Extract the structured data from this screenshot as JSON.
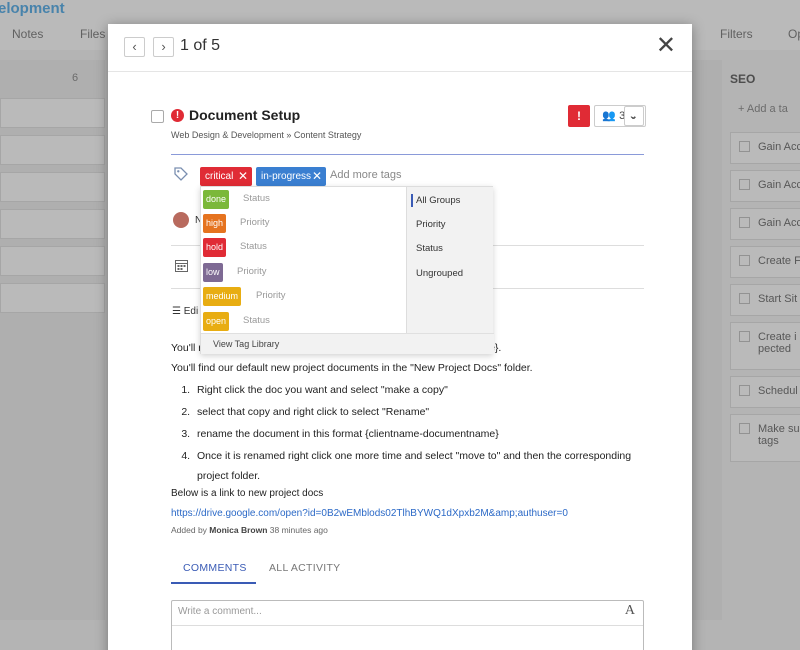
{
  "background": {
    "project_title": "elopment",
    "tabs": [
      "Notes",
      "Files",
      "Filters",
      "Op"
    ],
    "column_count": "6",
    "seo": {
      "title": "SEO",
      "add_label": "Add a ta",
      "items": [
        "Gain Acc",
        "Gain Acc",
        "Gain Acc",
        "Create F",
        "Start Sit",
        "Create i",
        "pected",
        "Schedul",
        "Make su",
        "tags"
      ]
    }
  },
  "modal": {
    "pager": "1 of 5",
    "prev_icon": "‹",
    "next_icon": "›",
    "close_icon": "✕",
    "task": {
      "title": "Document Setup",
      "breadcrumb": "Web Design & Development » Content Strategy",
      "assignee_count": "3",
      "alert_symbol": "!"
    },
    "tags": {
      "applied": [
        {
          "label": "critical",
          "color": "#e02b35"
        },
        {
          "label": "in-progress",
          "color": "#3a7fd1"
        }
      ],
      "placeholder": "Add more tags"
    },
    "rows": {
      "assignee_partial": "N",
      "edit_partial": "Edi"
    },
    "description": {
      "line1_start": "You'll r",
      "line1_end": "name}.",
      "line2": "You'll find our default new project documents in the \"New Project Docs\" folder.",
      "steps": [
        "Right click the doc you want and select \"make a copy\"",
        "select that copy and right click to select \"Rename\"",
        "rename the document in this format {clientname-documentname}",
        "Once it is renamed right click one more time and select \"move to\" and then the corresponding project folder."
      ],
      "link_intro": "Below is a link to new project docs",
      "link": "https://drive.google.com/open?id=0B2wEMblods02TlhBYWQ1dXpxb2M&amp;authuser=0",
      "added_prefix": "Added by",
      "added_by": "Monica Brown",
      "added_time": "38 minutes ago"
    },
    "tabs": {
      "comments": "COMMENTS",
      "activity": "ALL ACTIVITY"
    },
    "comment": {
      "placeholder": "Write a comment...",
      "font_icon": "A"
    }
  },
  "tag_dropdown": {
    "options": [
      {
        "label": "done",
        "group": "Status",
        "color": "#7bb83a"
      },
      {
        "label": "high",
        "group": "Priority",
        "color": "#e5731f"
      },
      {
        "label": "hold",
        "group": "Status",
        "color": "#e02b35"
      },
      {
        "label": "low",
        "group": "Priority",
        "color": "#7e6a94"
      },
      {
        "label": "medium",
        "group": "Priority",
        "color": "#e8ad12"
      },
      {
        "label": "open",
        "group": "Status",
        "color": "#e8ad12"
      }
    ],
    "groups": [
      "All Groups",
      "Priority",
      "Status",
      "Ungrouped"
    ],
    "selected_group": "All Groups",
    "footer": "View Tag Library"
  }
}
